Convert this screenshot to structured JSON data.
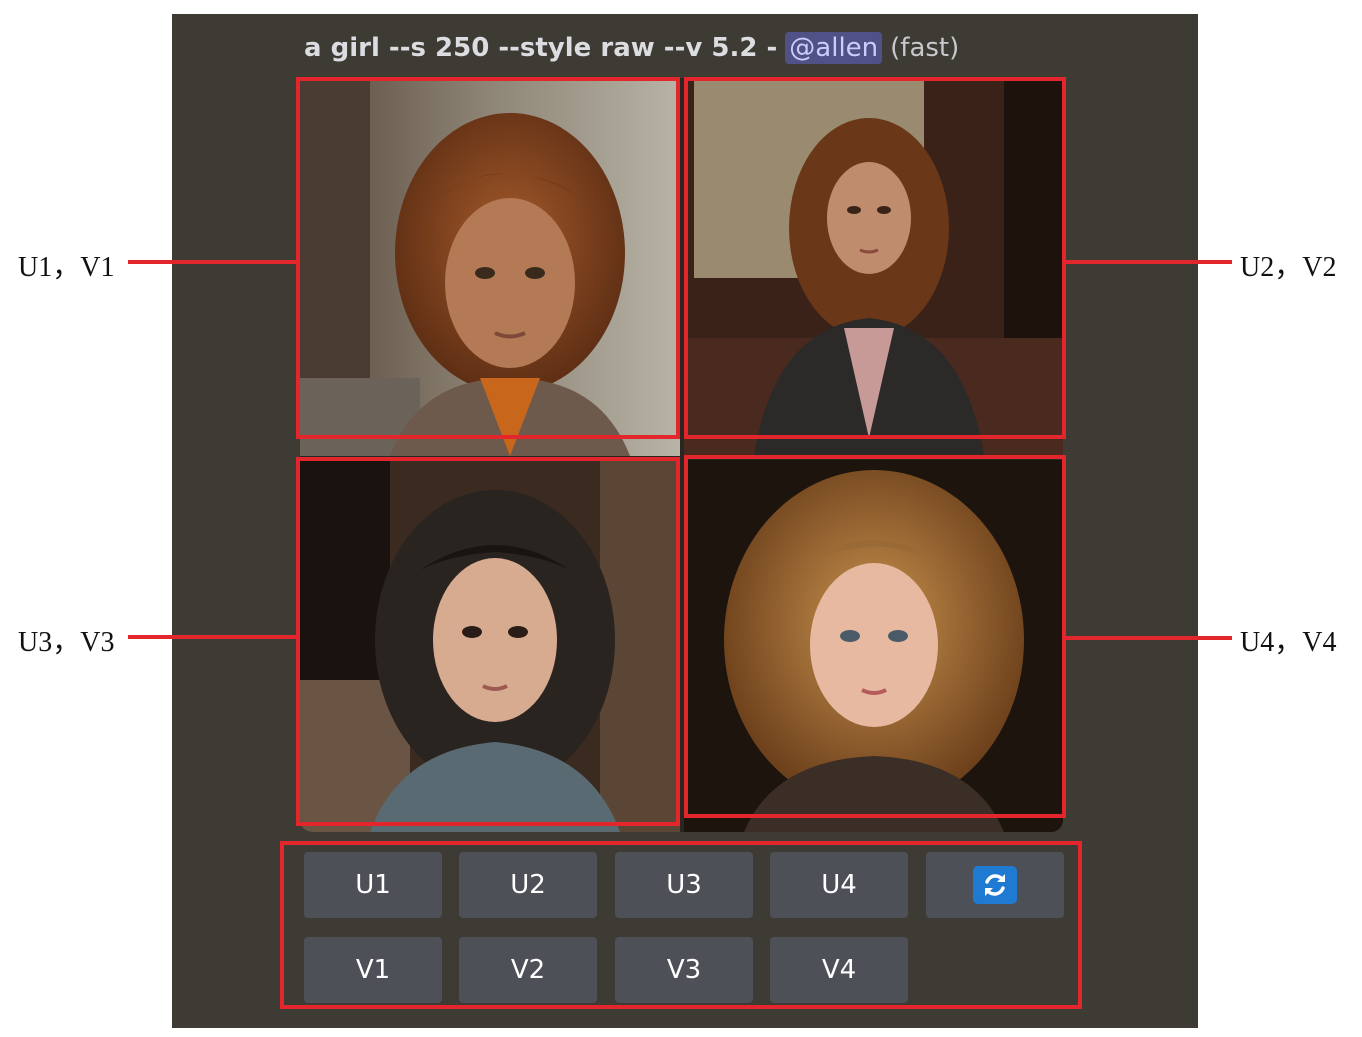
{
  "prompt": {
    "command": "a girl --s 250 --style raw --v 5.2 -",
    "mention": "@allen",
    "speed": "(fast)"
  },
  "callouts": {
    "q1": "U1，V1",
    "q2": "U2，V2",
    "q3": "U3，V3",
    "q4": "U4，V4"
  },
  "buttons": {
    "upscale": [
      "U1",
      "U2",
      "U3",
      "U4"
    ],
    "variation": [
      "V1",
      "V2",
      "V3",
      "V4"
    ],
    "reroll_icon": "refresh-icon"
  },
  "colors": {
    "panel": "#3e3a34",
    "highlight": "#e3262b",
    "button": "#4e5058",
    "reroll": "#1f7ad1",
    "mention_bg": "#4f5187"
  }
}
